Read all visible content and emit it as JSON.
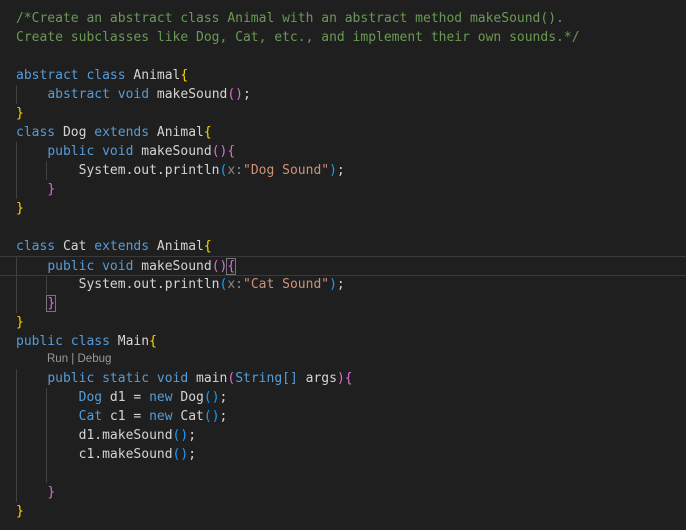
{
  "editor": {
    "language": "java",
    "codelens": {
      "run": "Run",
      "separator": " | ",
      "debug": "Debug"
    },
    "lines": [
      [
        {
          "t": "/*Create an abstract class Animal with an abstract method makeSound().",
          "c": "comment"
        }
      ],
      [
        {
          "t": "Create subclasses like Dog, Cat, etc., and implement their own sounds.*/",
          "c": "comment"
        }
      ],
      [],
      [
        {
          "t": "abstract",
          "c": "kw"
        },
        {
          "t": " ",
          "c": "plain"
        },
        {
          "t": "class",
          "c": "kw"
        },
        {
          "t": " ",
          "c": "plain"
        },
        {
          "t": "Animal",
          "c": "plain"
        },
        {
          "t": "{",
          "c": "b1"
        }
      ],
      [
        {
          "t": "    ",
          "c": "plain"
        },
        {
          "t": "abstract",
          "c": "kw"
        },
        {
          "t": " ",
          "c": "plain"
        },
        {
          "t": "void",
          "c": "kw"
        },
        {
          "t": " ",
          "c": "plain"
        },
        {
          "t": "makeSound",
          "c": "plain"
        },
        {
          "t": "()",
          "c": "b2"
        },
        {
          "t": ";",
          "c": "plain"
        }
      ],
      [
        {
          "t": "}",
          "c": "b1"
        }
      ],
      [
        {
          "t": "class",
          "c": "kw"
        },
        {
          "t": " ",
          "c": "plain"
        },
        {
          "t": "Dog",
          "c": "plain"
        },
        {
          "t": " ",
          "c": "plain"
        },
        {
          "t": "extends",
          "c": "kw"
        },
        {
          "t": " ",
          "c": "plain"
        },
        {
          "t": "Animal",
          "c": "plain"
        },
        {
          "t": "{",
          "c": "b1"
        }
      ],
      [
        {
          "t": "    ",
          "c": "plain"
        },
        {
          "t": "public",
          "c": "kw"
        },
        {
          "t": " ",
          "c": "plain"
        },
        {
          "t": "void",
          "c": "kw"
        },
        {
          "t": " ",
          "c": "plain"
        },
        {
          "t": "makeSound",
          "c": "plain"
        },
        {
          "t": "(){",
          "c": "b2"
        }
      ],
      [
        {
          "t": "        ",
          "c": "plain"
        },
        {
          "t": "System.out.println",
          "c": "plain"
        },
        {
          "t": "(",
          "c": "b3"
        },
        {
          "t": "x:",
          "c": "hint"
        },
        {
          "t": "\"Dog Sound\"",
          "c": "str"
        },
        {
          "t": ")",
          "c": "b3"
        },
        {
          "t": ";",
          "c": "plain"
        }
      ],
      [
        {
          "t": "    ",
          "c": "plain"
        },
        {
          "t": "}",
          "c": "b2"
        }
      ],
      [
        {
          "t": "}",
          "c": "b1"
        }
      ],
      [],
      [
        {
          "t": "class",
          "c": "kw"
        },
        {
          "t": " ",
          "c": "plain"
        },
        {
          "t": "Cat",
          "c": "plain"
        },
        {
          "t": " ",
          "c": "plain"
        },
        {
          "t": "extends",
          "c": "kw"
        },
        {
          "t": " ",
          "c": "plain"
        },
        {
          "t": "Animal",
          "c": "plain"
        },
        {
          "t": "{",
          "c": "b1"
        }
      ],
      [
        {
          "t": "    ",
          "c": "plain"
        },
        {
          "t": "public",
          "c": "kw"
        },
        {
          "t": " ",
          "c": "plain"
        },
        {
          "t": "void",
          "c": "kw"
        },
        {
          "t": " ",
          "c": "plain"
        },
        {
          "t": "makeSound",
          "c": "plain"
        },
        {
          "t": "()",
          "c": "b2"
        },
        {
          "t": "{",
          "c": "b2",
          "m": true
        }
      ],
      [
        {
          "t": "        ",
          "c": "plain"
        },
        {
          "t": "System.out.println",
          "c": "plain"
        },
        {
          "t": "(",
          "c": "b3"
        },
        {
          "t": "x:",
          "c": "hint"
        },
        {
          "t": "\"Cat Sound\"",
          "c": "str"
        },
        {
          "t": ")",
          "c": "b3"
        },
        {
          "t": ";",
          "c": "plain"
        }
      ],
      [
        {
          "t": "    ",
          "c": "plain"
        },
        {
          "t": "}",
          "c": "b2",
          "m": true
        }
      ],
      [
        {
          "t": "}",
          "c": "b1"
        }
      ],
      [
        {
          "t": "public",
          "c": "kw"
        },
        {
          "t": " ",
          "c": "plain"
        },
        {
          "t": "class",
          "c": "kw"
        },
        {
          "t": " ",
          "c": "plain"
        },
        {
          "t": "Main",
          "c": "plain"
        },
        {
          "t": "{",
          "c": "b1"
        }
      ],
      [
        {
          "t": "    ",
          "c": "plain"
        },
        {
          "t": "public",
          "c": "kw"
        },
        {
          "t": " ",
          "c": "plain"
        },
        {
          "t": "static",
          "c": "kw"
        },
        {
          "t": " ",
          "c": "plain"
        },
        {
          "t": "void",
          "c": "kw"
        },
        {
          "t": " ",
          "c": "plain"
        },
        {
          "t": "main",
          "c": "plain"
        },
        {
          "t": "(",
          "c": "b2"
        },
        {
          "t": "String[]",
          "c": "kw"
        },
        {
          "t": " ",
          "c": "plain"
        },
        {
          "t": "args",
          "c": "plain"
        },
        {
          "t": "){",
          "c": "b2"
        }
      ],
      [
        {
          "t": "        ",
          "c": "plain"
        },
        {
          "t": "Dog",
          "c": "kw"
        },
        {
          "t": " d1 = ",
          "c": "plain"
        },
        {
          "t": "new",
          "c": "kw"
        },
        {
          "t": " ",
          "c": "plain"
        },
        {
          "t": "Dog",
          "c": "plain"
        },
        {
          "t": "()",
          "c": "b3"
        },
        {
          "t": ";",
          "c": "plain"
        }
      ],
      [
        {
          "t": "        ",
          "c": "plain"
        },
        {
          "t": "Cat",
          "c": "kw"
        },
        {
          "t": " c1 = ",
          "c": "plain"
        },
        {
          "t": "new",
          "c": "kw"
        },
        {
          "t": " ",
          "c": "plain"
        },
        {
          "t": "Cat",
          "c": "plain"
        },
        {
          "t": "()",
          "c": "b3"
        },
        {
          "t": ";",
          "c": "plain"
        }
      ],
      [
        {
          "t": "        ",
          "c": "plain"
        },
        {
          "t": "d1.makeSound",
          "c": "plain"
        },
        {
          "t": "()",
          "c": "b3"
        },
        {
          "t": ";",
          "c": "plain"
        }
      ],
      [
        {
          "t": "        ",
          "c": "plain"
        },
        {
          "t": "c1.makeSound",
          "c": "plain"
        },
        {
          "t": "()",
          "c": "b3"
        },
        {
          "t": ";",
          "c": "plain"
        }
      ],
      [],
      [
        {
          "t": "    ",
          "c": "plain"
        },
        {
          "t": "}",
          "c": "b2"
        }
      ],
      [
        {
          "t": "}",
          "c": "b1"
        }
      ]
    ]
  }
}
